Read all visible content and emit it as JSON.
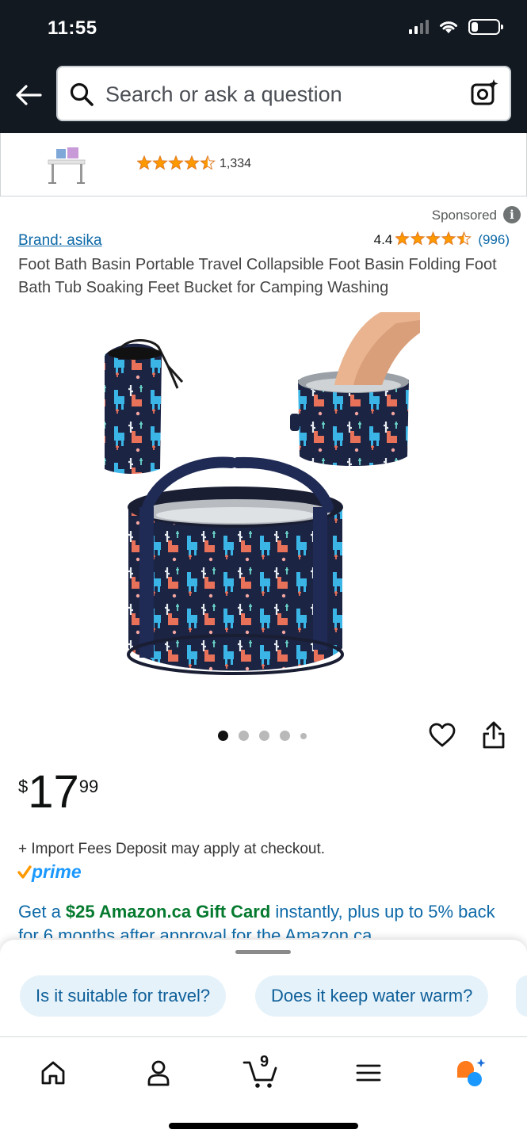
{
  "status_bar": {
    "time": "11:55",
    "battery_percent": 25
  },
  "search": {
    "placeholder": "Search or ask a question"
  },
  "top_ad": {
    "review_count": "1,334",
    "rating_stars": 4.5
  },
  "sponsored_label": "Sponsored",
  "product": {
    "brand": "Brand: asika",
    "rating": "4.4",
    "rating_stars": 4.5,
    "reviews": "(996)",
    "title": "Foot Bath Basin Portable Travel Collapsible Foot Basin Folding Foot Bath Tub Soaking Feet Bucket for Camping Washing",
    "image_dots": {
      "count": 5,
      "active": 1
    },
    "price": {
      "symbol": "$",
      "whole": "17",
      "fraction": "99"
    },
    "import_fees": "+ Import Fees Deposit may apply at checkout.",
    "prime": "prime",
    "promo": {
      "prefix": "Get a ",
      "highlight": "$25 Amazon.ca Gift Card",
      "rest": " instantly, plus up to 5% back for 6 months after approval for the Amazon.ca"
    }
  },
  "suggestions": [
    "Is it suitable for travel?",
    "Does it keep water warm?"
  ],
  "bottom_nav": {
    "cart_count": "9",
    "items": [
      "home-icon",
      "account-icon",
      "cart-icon",
      "menu-icon",
      "assistant-icon"
    ]
  },
  "colors": {
    "header": "#131921",
    "link": "#0e6aa8",
    "star": "#ff9900",
    "prime": "#1a98ff",
    "promo_highlight": "#057a2f"
  }
}
